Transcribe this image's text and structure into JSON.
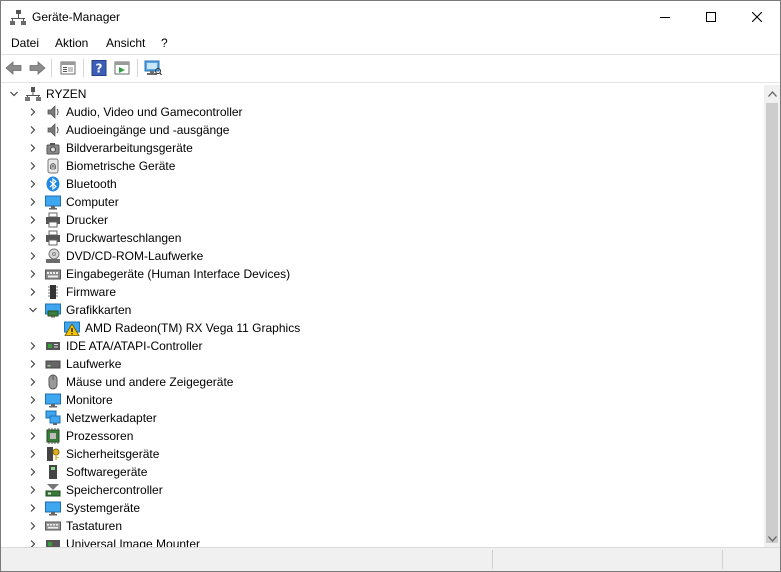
{
  "window": {
    "title": "Geräte-Manager"
  },
  "menu": {
    "items": [
      "Datei",
      "Aktion",
      "Ansicht",
      "?"
    ]
  },
  "toolbar": {
    "buttons": [
      {
        "icon": "back-arrow-icon"
      },
      {
        "icon": "forward-arrow-icon"
      },
      {
        "icon": "properties-icon"
      },
      {
        "icon": "help-icon"
      },
      {
        "icon": "run-icon"
      },
      {
        "icon": "scan-hardware-icon"
      }
    ]
  },
  "tree": {
    "root": {
      "label": "RYZEN",
      "icon": "computer-root-icon",
      "expanded": true
    },
    "items": [
      {
        "label": "Audio, Video und Gamecontroller",
        "icon": "speaker-icon",
        "expanded": false
      },
      {
        "label": "Audioeingänge und -ausgänge",
        "icon": "speaker-icon",
        "expanded": false
      },
      {
        "label": "Bildverarbeitungsgeräte",
        "icon": "camera-icon",
        "expanded": false
      },
      {
        "label": "Biometrische Geräte",
        "icon": "fingerprint-icon",
        "expanded": false
      },
      {
        "label": "Bluetooth",
        "icon": "bluetooth-icon",
        "expanded": false
      },
      {
        "label": "Computer",
        "icon": "monitor-icon",
        "expanded": false
      },
      {
        "label": "Drucker",
        "icon": "printer-icon",
        "expanded": false
      },
      {
        "label": "Druckwarteschlangen",
        "icon": "printer-icon",
        "expanded": false
      },
      {
        "label": "DVD/CD-ROM-Laufwerke",
        "icon": "disc-drive-icon",
        "expanded": false
      },
      {
        "label": "Eingabegeräte (Human Interface Devices)",
        "icon": "keyboard-hid-icon",
        "expanded": false
      },
      {
        "label": "Firmware",
        "icon": "firmware-icon",
        "expanded": false
      },
      {
        "label": "Grafikkarten",
        "icon": "display-adapter-icon",
        "expanded": true
      },
      {
        "label": "AMD Radeon(TM) RX Vega 11 Graphics",
        "icon": "warning-icon",
        "child": true
      },
      {
        "label": "IDE ATA/ATAPI-Controller",
        "icon": "controller-icon",
        "expanded": false
      },
      {
        "label": "Laufwerke",
        "icon": "disk-drive-icon",
        "expanded": false
      },
      {
        "label": "Mäuse und andere Zeigegeräte",
        "icon": "mouse-icon",
        "expanded": false
      },
      {
        "label": "Monitore",
        "icon": "monitor-icon",
        "expanded": false
      },
      {
        "label": "Netzwerkadapter",
        "icon": "network-icon",
        "expanded": false
      },
      {
        "label": "Prozessoren",
        "icon": "processor-icon",
        "expanded": false
      },
      {
        "label": "Sicherheitsgeräte",
        "icon": "security-key-icon",
        "expanded": false
      },
      {
        "label": "Softwaregeräte",
        "icon": "software-device-icon",
        "expanded": false
      },
      {
        "label": "Speichercontroller",
        "icon": "storage-controller-icon",
        "expanded": false
      },
      {
        "label": "Systemgeräte",
        "icon": "system-device-icon",
        "expanded": false
      },
      {
        "label": "Tastaturen",
        "icon": "keyboard-icon",
        "expanded": false
      },
      {
        "label": "Universal Image Mounter",
        "icon": "image-mounter-icon",
        "expanded": false
      }
    ]
  },
  "colors": {
    "accent_blue": "#1e88e5",
    "warning_yellow": "#f5c400"
  }
}
